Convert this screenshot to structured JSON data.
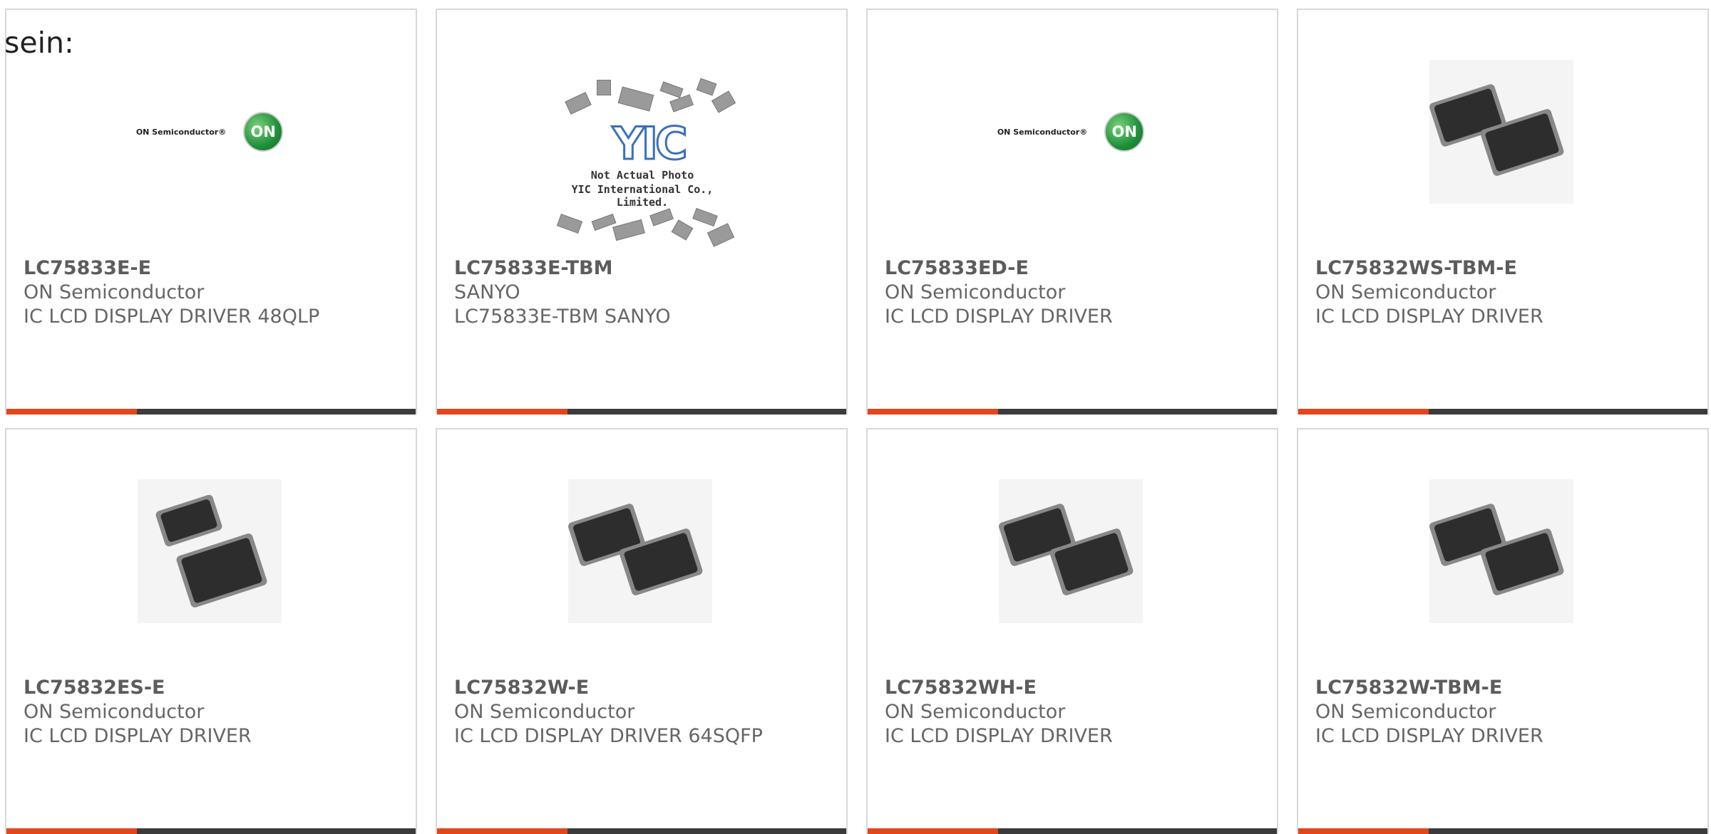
{
  "lead_text": "sein:",
  "yic_placeholder": {
    "mark": "YIC",
    "line1": "Not Actual Photo",
    "line2": "YIC International Co., Limited."
  },
  "on_logo_text": "ON Semiconductor®",
  "on_logo_mark": "ON",
  "colors": {
    "accent": "#e2461a",
    "bar": "#3b3b3b",
    "border": "#d8d8d8"
  },
  "cards": [
    {
      "part": "LC75833E-E",
      "manufacturer": "ON Semiconductor",
      "description": "IC LCD DISPLAY DRIVER 48QLP",
      "image": "on-semiconductor-logo"
    },
    {
      "part": "LC75833E-TBM",
      "manufacturer": "SANYO",
      "description": "LC75833E-TBM SANYO",
      "image": "yic-not-actual-photo"
    },
    {
      "part": "LC75833ED-E",
      "manufacturer": "ON Semiconductor",
      "description": "IC LCD DISPLAY DRIVER",
      "image": "on-semiconductor-logo"
    },
    {
      "part": "LC75832WS-TBM-E",
      "manufacturer": "ON Semiconductor",
      "description": "IC LCD DISPLAY DRIVER",
      "image": "qfp-chip-photo"
    },
    {
      "part": "LC75832ES-E",
      "manufacturer": "ON Semiconductor",
      "description": "IC LCD DISPLAY DRIVER",
      "image": "qfp-chip-photo"
    },
    {
      "part": "LC75832W-E",
      "manufacturer": "ON Semiconductor",
      "description": "IC LCD DISPLAY DRIVER 64SQFP",
      "image": "qfp-chip-photo"
    },
    {
      "part": "LC75832WH-E",
      "manufacturer": "ON Semiconductor",
      "description": "IC LCD DISPLAY DRIVER",
      "image": "qfp-chip-photo"
    },
    {
      "part": "LC75832W-TBM-E",
      "manufacturer": "ON Semiconductor",
      "description": "IC LCD DISPLAY DRIVER",
      "image": "qfp-chip-photo"
    }
  ]
}
